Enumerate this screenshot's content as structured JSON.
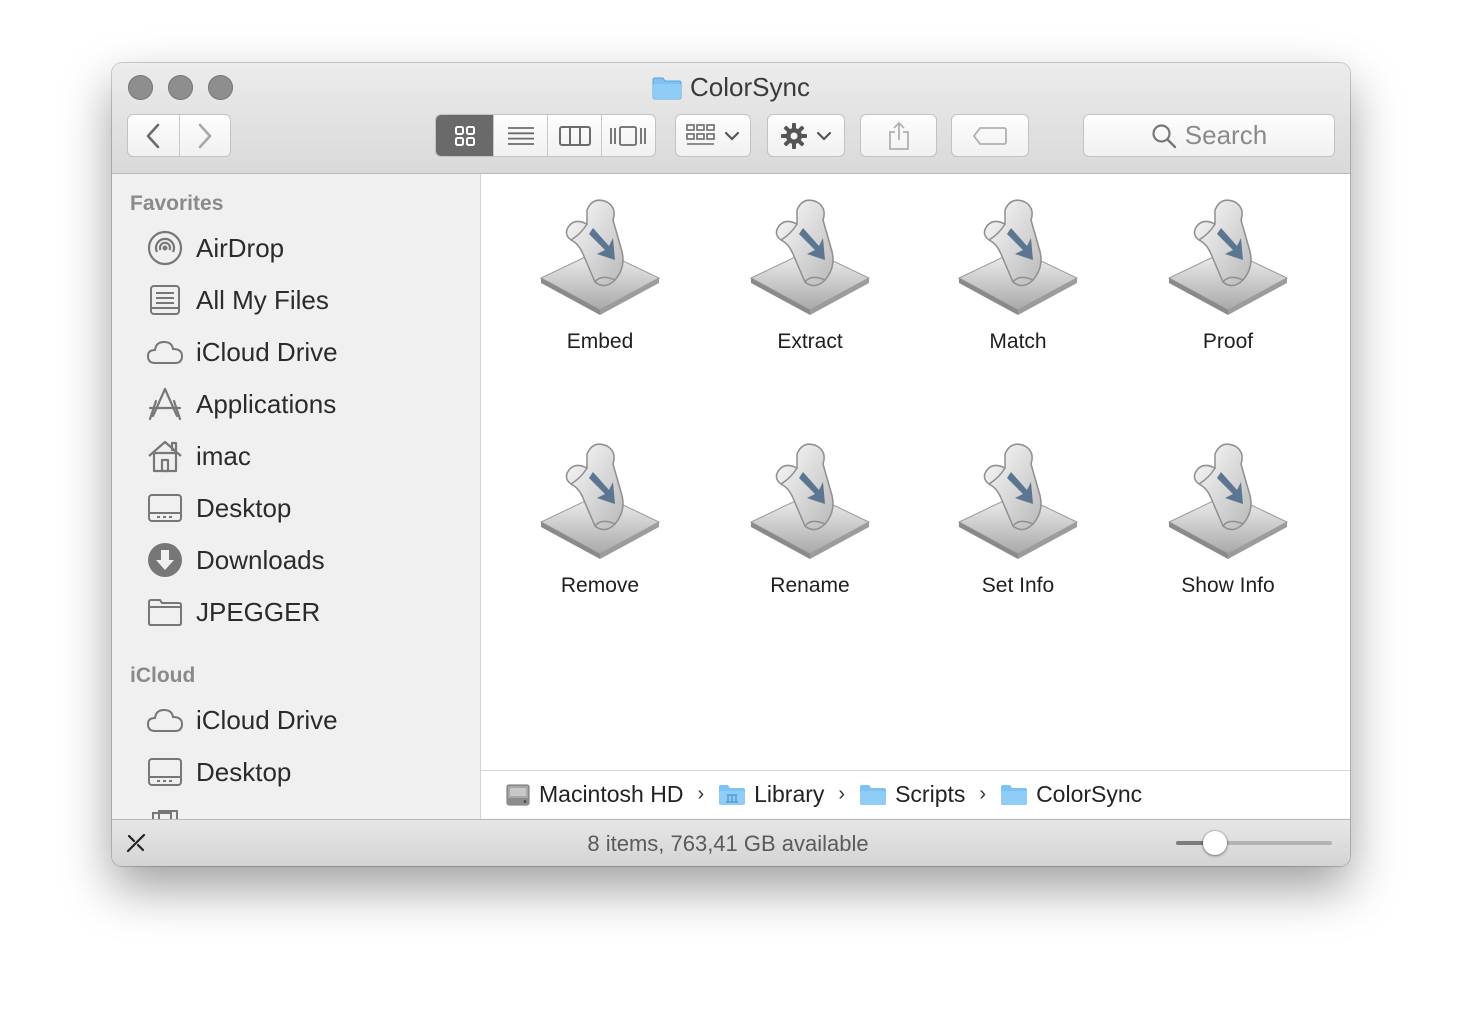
{
  "window": {
    "title": "ColorSync",
    "title_icon": "folder-icon"
  },
  "toolbar": {
    "back_icon": "chevron-left-icon",
    "forward_icon": "chevron-right-icon",
    "views": [
      "icon-view-icon",
      "list-view-icon",
      "column-view-icon",
      "cover-flow-icon"
    ],
    "active_view": 0,
    "arrange_icon": "arrange-grid-icon",
    "action_icon": "gear-icon",
    "share_icon": "share-icon",
    "tag_icon": "tag-icon",
    "search_placeholder": "Search"
  },
  "sidebar": {
    "favorites_header": "Favorites",
    "favorites": [
      {
        "label": "AirDrop",
        "icon": "airdrop-icon"
      },
      {
        "label": "All My Files",
        "icon": "all-files-icon"
      },
      {
        "label": "iCloud Drive",
        "icon": "cloud-icon"
      },
      {
        "label": "Applications",
        "icon": "applications-icon"
      },
      {
        "label": "imac",
        "icon": "home-icon"
      },
      {
        "label": "Desktop",
        "icon": "desktop-icon"
      },
      {
        "label": "Downloads",
        "icon": "downloads-icon"
      },
      {
        "label": "JPEGGER",
        "icon": "folder-icon"
      }
    ],
    "icloud_header": "iCloud",
    "icloud": [
      {
        "label": "iCloud Drive",
        "icon": "cloud-icon"
      },
      {
        "label": "Desktop",
        "icon": "desktop-icon"
      }
    ]
  },
  "files": [
    {
      "name": "Embed"
    },
    {
      "name": "Extract"
    },
    {
      "name": "Match"
    },
    {
      "name": "Proof"
    },
    {
      "name": "Remove"
    },
    {
      "name": "Rename"
    },
    {
      "name": "Set Info"
    },
    {
      "name": "Show Info"
    }
  ],
  "pathbar": [
    {
      "label": "Macintosh HD",
      "icon": "hard-drive-icon"
    },
    {
      "label": "Library",
      "icon": "library-folder-icon"
    },
    {
      "label": "Scripts",
      "icon": "folder-icon"
    },
    {
      "label": "ColorSync",
      "icon": "folder-icon"
    }
  ],
  "status": {
    "text": "8 items, 763,41 GB available",
    "icon_size_fraction": 0.25
  },
  "colors": {
    "folder_blue": "#7cc2f2",
    "active_view_bg": "#6a6a6a"
  }
}
